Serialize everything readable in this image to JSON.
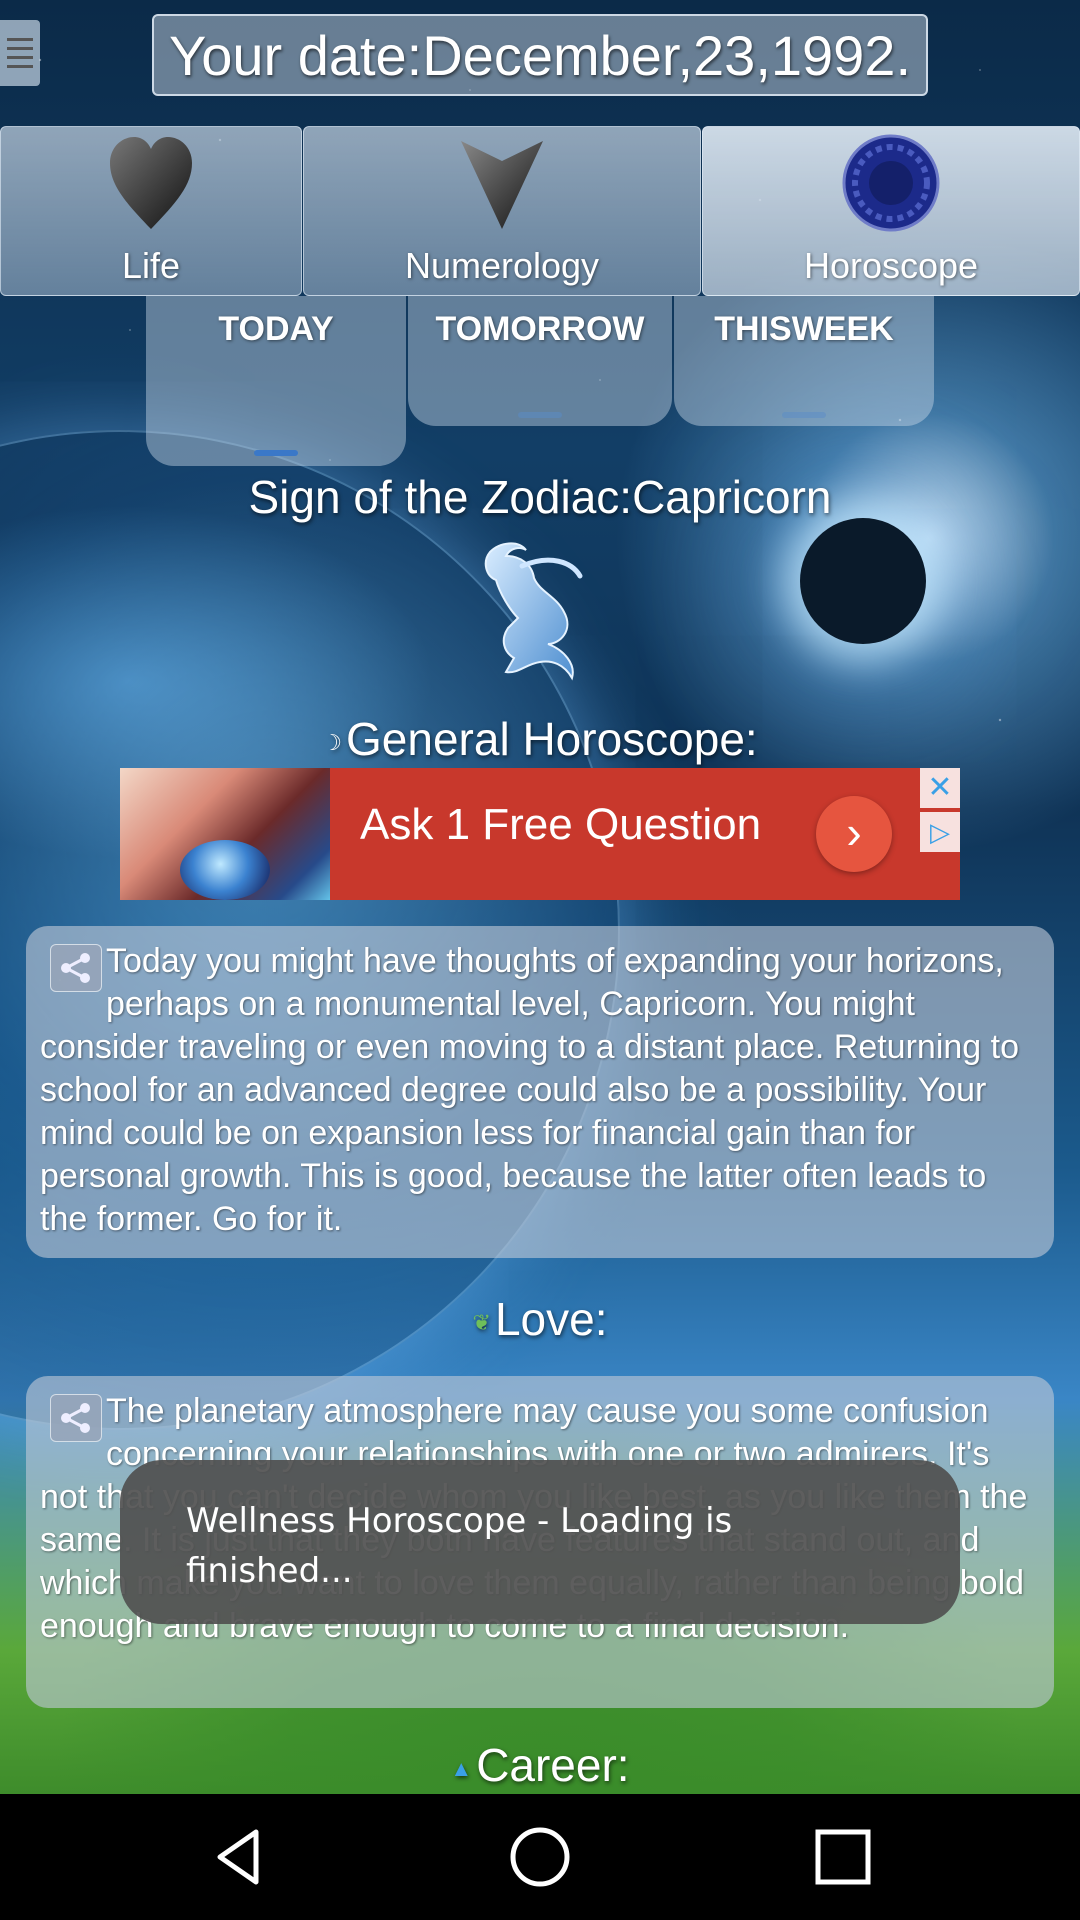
{
  "header": {
    "date_text": "Your date:December,23,1992."
  },
  "categories": [
    {
      "label": "Life",
      "icon": "heart-icon",
      "active": false
    },
    {
      "label": "Numerology",
      "icon": "triangle-icon",
      "active": false
    },
    {
      "label": "Horoscope",
      "icon": "zodiac-wheel-icon",
      "active": true
    }
  ],
  "periods": [
    {
      "label": "TODAY",
      "selected": true
    },
    {
      "label": "TOMORROW",
      "selected": false
    },
    {
      "label": "THISWEEK",
      "selected": false
    }
  ],
  "zodiac": {
    "title": "Sign of the Zodiac:Capricorn",
    "icon": "capricorn-icon"
  },
  "general": {
    "title": "General Horoscope:",
    "text": "Today you might have thoughts of expanding your horizons, perhaps on a monumental level, Capricorn. You might consider traveling or even moving to a distant place. Returning to school for an advanced degree could also be a possibility. Your mind could be on expansion less for financial gain than for personal growth. This is good, because the latter often leads to the former. Go for it."
  },
  "ad": {
    "text": "Ask 1 Free Question",
    "color": "#c8382c"
  },
  "love": {
    "title": "Love:",
    "text": "The planetary atmosphere may cause you some confusion concerning your relationships with one or two admirers. It's not that you can't decide whom you like best, as you like them the same. It is just that they both have features that stand out, and which make you want to love them equally, rather than being bold enough and brave enough to come to a final decision."
  },
  "career": {
    "title": "Career:"
  },
  "toast": {
    "text": "Wellness Horoscope - Loading is finished..."
  },
  "nav": {
    "back": "back-icon",
    "home": "home-icon",
    "recents": "recents-icon"
  }
}
